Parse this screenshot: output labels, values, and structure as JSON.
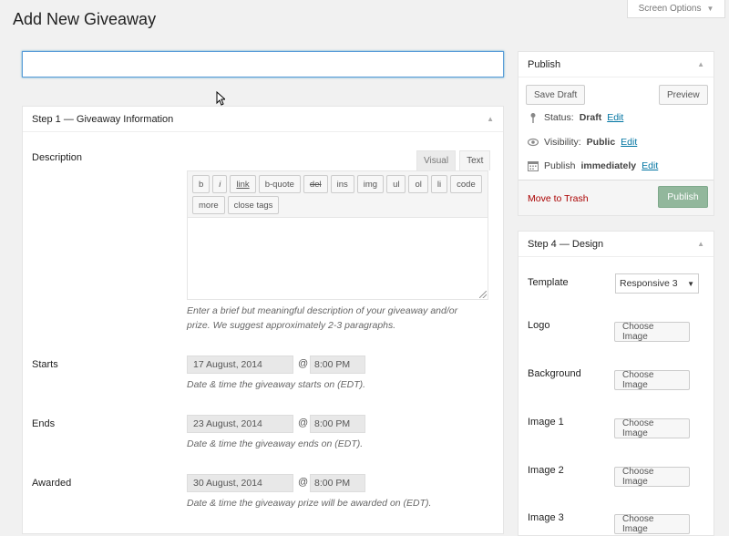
{
  "screen_options": {
    "label": "Screen Options",
    "arrow": "▼"
  },
  "page": {
    "title": "Add New Giveaway"
  },
  "title_input": {
    "value": "",
    "placeholder": ""
  },
  "step1": {
    "title": "Step 1 — Giveaway Information",
    "description": {
      "label": "Description",
      "tabs": [
        "Visual",
        "Text"
      ],
      "quicktags": [
        "b",
        "i",
        "link",
        "b-quote",
        "del",
        "ins",
        "img",
        "ul",
        "ol",
        "li",
        "code",
        "more",
        "close tags"
      ],
      "value": "",
      "help": "Enter a brief but meaningful description of your giveaway and/or prize. We suggest approximately 2-3 paragraphs."
    },
    "starts": {
      "label": "Starts",
      "date": "17 August, 2014",
      "at": "@",
      "time": "8:00 PM",
      "help": "Date & time the giveaway starts on (EDT)."
    },
    "ends": {
      "label": "Ends",
      "date": "23 August, 2014",
      "at": "@",
      "time": "8:00 PM",
      "help": "Date & time the giveaway ends on (EDT)."
    },
    "awarded": {
      "label": "Awarded",
      "date": "30 August, 2014",
      "at": "@",
      "time": "8:00 PM",
      "help": "Date & time the giveaway prize will be awarded on (EDT)."
    }
  },
  "publish": {
    "title": "Publish",
    "save_draft": "Save Draft",
    "preview": "Preview",
    "status_label": "Status:",
    "status_value": "Draft",
    "visibility_label": "Visibility:",
    "visibility_value": "Public",
    "schedule_label": "Publish",
    "schedule_value": "immediately",
    "edit": "Edit",
    "move_to_trash": "Move to Trash",
    "publish_button": "Publish",
    "publish_color": "#92b79c"
  },
  "step4": {
    "title": "Step 4 — Design",
    "template_label": "Template",
    "template_value": "Responsive 3",
    "choose_image": "Choose Image",
    "images": [
      "Logo",
      "Background",
      "Image 1",
      "Image 2",
      "Image 3"
    ]
  },
  "icons": {
    "status": "pin-icon",
    "visibility": "eye-icon",
    "schedule": "calendar-icon",
    "collapse": "triangle-up-icon"
  }
}
